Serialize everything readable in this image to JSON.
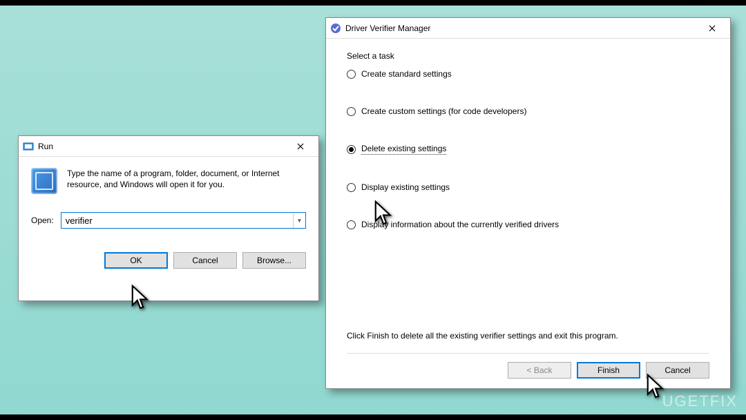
{
  "run": {
    "title": "Run",
    "description": "Type the name of a program, folder, document, or Internet resource, and Windows will open it for you.",
    "open_label": "Open:",
    "input_value": "verifier",
    "buttons": {
      "ok": "OK",
      "cancel": "Cancel",
      "browse": "Browse..."
    }
  },
  "verifier": {
    "title": "Driver Verifier Manager",
    "group_label": "Select a task",
    "options": [
      {
        "label": "Create standard settings",
        "checked": false
      },
      {
        "label": "Create custom settings (for code developers)",
        "checked": false
      },
      {
        "label": "Delete existing settings",
        "checked": true
      },
      {
        "label": "Display existing settings",
        "checked": false
      },
      {
        "label": "Display information about the currently verified drivers",
        "checked": false
      }
    ],
    "hint": "Click Finish to delete all the existing verifier settings and exit this program.",
    "buttons": {
      "back": "< Back",
      "finish": "Finish",
      "cancel": "Cancel"
    }
  },
  "watermark": "UGETFIX"
}
